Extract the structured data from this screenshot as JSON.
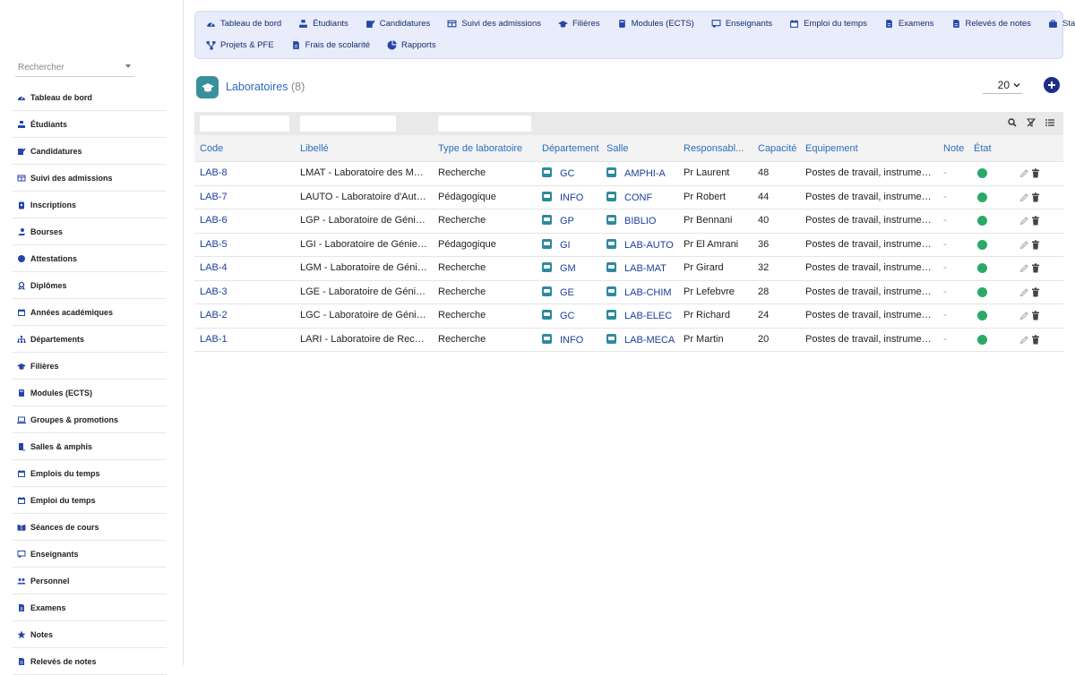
{
  "sidebar": {
    "search_placeholder": "Rechercher",
    "items": [
      {
        "label": "Tableau de bord",
        "icon": "dashboard-icon"
      },
      {
        "label": "Étudiants",
        "icon": "student-icon"
      },
      {
        "label": "Candidatures",
        "icon": "application-icon"
      },
      {
        "label": "Suivi des admissions",
        "icon": "table-icon"
      },
      {
        "label": "Inscriptions",
        "icon": "clipboard-icon"
      },
      {
        "label": "Bourses",
        "icon": "hand-coin-icon"
      },
      {
        "label": "Attestations",
        "icon": "certificate-icon"
      },
      {
        "label": "Diplômes",
        "icon": "award-icon"
      },
      {
        "label": "Années académiques",
        "icon": "calendar-icon"
      },
      {
        "label": "Départements",
        "icon": "sitemap-icon"
      },
      {
        "label": "Filières",
        "icon": "graduation-cap-icon"
      },
      {
        "label": "Modules (ECTS)",
        "icon": "book-icon"
      },
      {
        "label": "Groupes & promotions",
        "icon": "laptop-icon"
      },
      {
        "label": "Salles & amphis",
        "icon": "door-icon"
      },
      {
        "label": "Emplois du temps",
        "icon": "calendar-icon"
      },
      {
        "label": "Emploi du temps",
        "icon": "calendar-icon"
      },
      {
        "label": "Séances de cours",
        "icon": "open-book-icon"
      },
      {
        "label": "Enseignants",
        "icon": "teacher-icon"
      },
      {
        "label": "Personnel",
        "icon": "users-icon"
      },
      {
        "label": "Examens",
        "icon": "document-icon"
      },
      {
        "label": "Notes",
        "icon": "star-icon"
      },
      {
        "label": "Relevés de notes",
        "icon": "document-icon"
      }
    ]
  },
  "topnav": {
    "row1": [
      {
        "label": "Tableau de bord",
        "icon": "dashboard-icon"
      },
      {
        "label": "Étudiants",
        "icon": "student-icon"
      },
      {
        "label": "Candidatures",
        "icon": "application-icon"
      },
      {
        "label": "Suivi des admissions",
        "icon": "table-icon"
      },
      {
        "label": "Filières",
        "icon": "graduation-cap-icon"
      },
      {
        "label": "Modules (ECTS)",
        "icon": "book-icon"
      },
      {
        "label": "Enseignants",
        "icon": "teacher-icon"
      },
      {
        "label": "Emploi du temps",
        "icon": "calendar-icon"
      },
      {
        "label": "Examens",
        "icon": "document-icon"
      },
      {
        "label": "Relevés de notes",
        "icon": "document-icon"
      },
      {
        "label": "Stages",
        "icon": "briefcase-icon"
      }
    ],
    "row2": [
      {
        "label": "Projets & PFE",
        "icon": "project-icon"
      },
      {
        "label": "Frais de scolarité",
        "icon": "document-icon"
      },
      {
        "label": "Rapports",
        "icon": "pie-chart-icon"
      }
    ]
  },
  "page": {
    "title": "Laboratoires",
    "count": "(8)",
    "page_size": "20"
  },
  "table": {
    "headers": {
      "code": "Code",
      "libelle": "Libellé",
      "type": "Type de laboratoire",
      "departement": "Département",
      "salle": "Salle",
      "responsable": "Responsabl...",
      "capacite": "Capacité",
      "equipement": "Equipement",
      "note": "Note",
      "etat": "État"
    },
    "rows": [
      {
        "code": "LAB-8",
        "libelle": "LMAT - Laboratoire des Mat...",
        "type": "Recherche",
        "departement": "GC",
        "salle": "AMPHI-A",
        "responsable": "Pr Laurent",
        "capacite": "48",
        "equipement": "Postes de travail, instrumen...",
        "note": "-"
      },
      {
        "code": "LAB-7",
        "libelle": "LAUTO - Laboratoire d'Auto...",
        "type": "Pédagogique",
        "departement": "INFO",
        "salle": "CONF",
        "responsable": "Pr Robert",
        "capacite": "44",
        "equipement": "Postes de travail, instrumen...",
        "note": "-"
      },
      {
        "code": "LAB-6",
        "libelle": "LGP - Laboratoire de Génie ...",
        "type": "Recherche",
        "departement": "GP",
        "salle": "BIBLIO",
        "responsable": "Pr Bennani",
        "capacite": "40",
        "equipement": "Postes de travail, instrumen...",
        "note": "-"
      },
      {
        "code": "LAB-5",
        "libelle": "LGI - Laboratoire de Génie I...",
        "type": "Pédagogique",
        "departement": "GI",
        "salle": "LAB-AUTO",
        "responsable": "Pr El Amrani",
        "capacite": "36",
        "equipement": "Postes de travail, instrumen...",
        "note": "-"
      },
      {
        "code": "LAB-4",
        "libelle": "LGM - Laboratoire de Génie...",
        "type": "Recherche",
        "departement": "GM",
        "salle": "LAB-MAT",
        "responsable": "Pr Girard",
        "capacite": "32",
        "equipement": "Postes de travail, instrumen...",
        "note": "-"
      },
      {
        "code": "LAB-3",
        "libelle": "LGE - Laboratoire de Génie ...",
        "type": "Recherche",
        "departement": "GE",
        "salle": "LAB-CHIM",
        "responsable": "Pr Lefebvre",
        "capacite": "28",
        "equipement": "Postes de travail, instrumen...",
        "note": "-"
      },
      {
        "code": "LAB-2",
        "libelle": "LGC - Laboratoire de Génie...",
        "type": "Recherche",
        "departement": "GC",
        "salle": "LAB-ELEC",
        "responsable": "Pr Richard",
        "capacite": "24",
        "equipement": "Postes de travail, instrumen...",
        "note": "-"
      },
      {
        "code": "LAB-1",
        "libelle": "LARI - Laboratoire de Rech...",
        "type": "Recherche",
        "departement": "INFO",
        "salle": "LAB-MECA",
        "responsable": "Pr Martin",
        "capacite": "20",
        "equipement": "Postes de travail, instrumen...",
        "note": "-"
      }
    ]
  },
  "colors": {
    "accent": "#2a6dc0",
    "status_active": "#2aa96b",
    "nav_bg": "#e8ecfb"
  }
}
